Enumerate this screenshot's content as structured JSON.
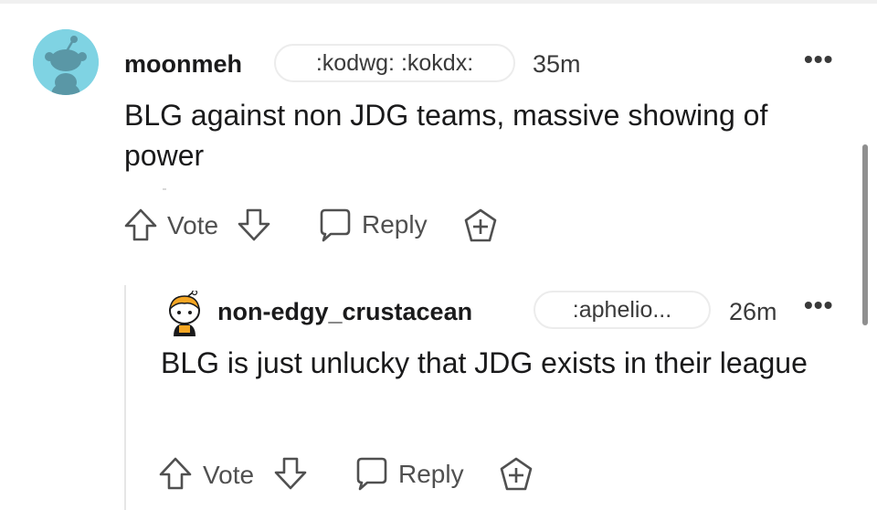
{
  "comments": [
    {
      "username": "moonmeh",
      "flair": ":kodwg: :kokdx:",
      "time": "35m",
      "more": "•••",
      "body": "BLG against non JDG teams, massive showing of power",
      "actions": {
        "vote_label": "Vote",
        "reply_label": "Reply"
      },
      "avatar_icon": "snoo-avatar-icon"
    },
    {
      "username": "non-edgy_crustacean",
      "flair": ":aphelio...",
      "time": "26m",
      "more": "•••",
      "body": "BLG is just unlucky that JDG exists in their league",
      "actions": {
        "vote_label": "Vote",
        "reply_label": "Reply"
      },
      "avatar_icon": "snoo-avatar-icon"
    }
  ],
  "colors": {
    "avatar_bg_1": "#7fd3e3",
    "text": "#1a1a1b",
    "muted": "#505050",
    "border": "#ececec"
  }
}
